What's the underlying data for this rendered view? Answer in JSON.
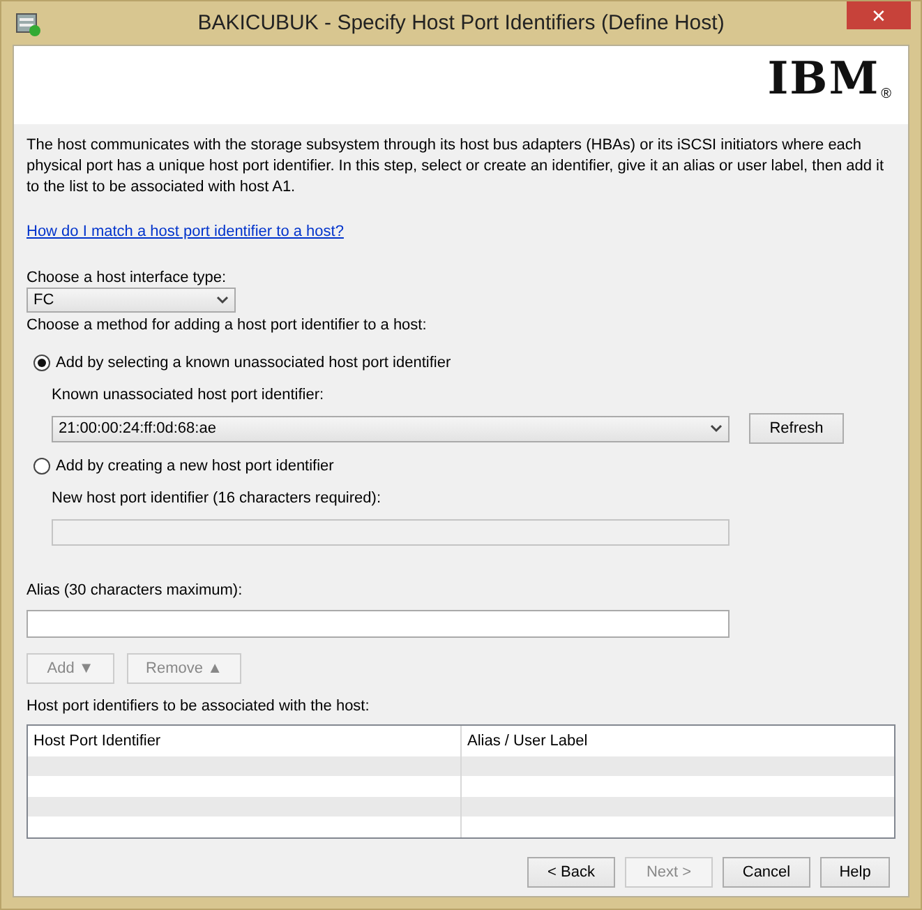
{
  "window": {
    "title": "BAKICUBUK - Specify Host Port Identifiers (Define Host)",
    "close": "✕"
  },
  "logo": {
    "text": "IBM",
    "mark": "®"
  },
  "intro": "The host communicates with the storage subsystem through its host bus adapters (HBAs) or its iSCSI initiators where each physical port has a unique host port identifier. In this step, select or create an identifier, give it an alias or user label, then add it to the list to be associated with host A1.",
  "help_link": "How do I match a host port identifier to a host?",
  "interface_type": {
    "label": "Choose a host interface type:",
    "value": "FC"
  },
  "method_label": "Choose a method for adding a host port identifier to a host:",
  "methods": [
    {
      "kind": "select",
      "label": "Add by selecting a known unassociated host port identifier",
      "selected": true,
      "field": {
        "label": "Known unassociated host port identifier:",
        "value": "21:00:00:24:ff:0d:68:ae",
        "disabled": false
      },
      "button": "Refresh"
    },
    {
      "kind": "text",
      "label": "Add by creating a new host port identifier",
      "selected": false,
      "field": {
        "label": "New host port identifier (16 characters required):",
        "disabled": true
      }
    }
  ],
  "alias": {
    "label": "Alias (30 characters maximum):"
  },
  "list_buttons": [
    {
      "label": "Add ▼",
      "disabled": true
    },
    {
      "label": "Remove ▲",
      "disabled": true
    }
  ],
  "table": {
    "label": "Host port identifiers to be associated with the host:",
    "columns": [
      "Host Port Identifier",
      "Alias / User Label"
    ]
  },
  "footer_buttons": [
    {
      "label": "< Back",
      "disabled": false
    },
    {
      "label": "Next >",
      "disabled": true
    },
    {
      "label": "Cancel",
      "disabled": false
    },
    {
      "label": "Help",
      "disabled": false
    }
  ]
}
